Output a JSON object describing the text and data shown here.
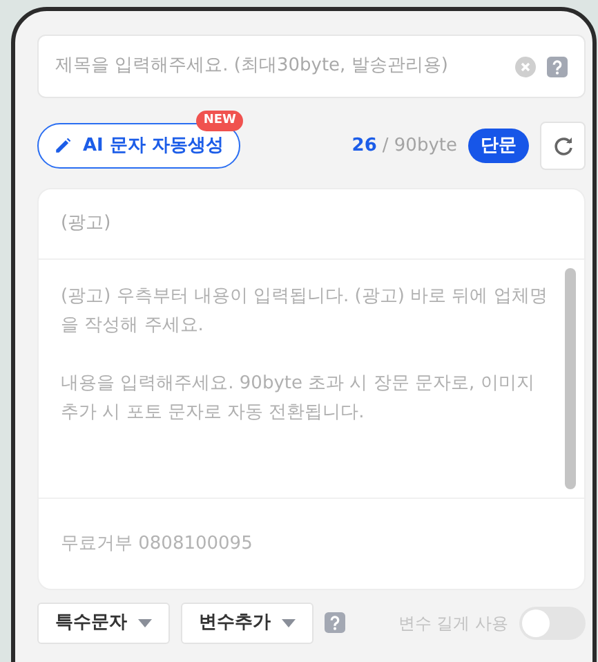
{
  "title_field": {
    "placeholder": "제목을 입력해주세요. (최대30byte, 발송관리용)"
  },
  "ai_button": {
    "label": "AI 문자 자동생성",
    "badge": "NEW"
  },
  "byte_counter": {
    "count": "26",
    "limit": "/ 90byte"
  },
  "message_type": {
    "label": "단문"
  },
  "message": {
    "prefix": "(광고)",
    "placeholder_paragraphs": [
      "(광고) 우측부터 내용이 입력됩니다. (광고) 바로 뒤에 업체명을 작성해 주세요.",
      "내용을 입력해주세요. 90byte 초과 시 장문 문자로, 이미지 추가 시 포토 문자로 자동 전환됩니다."
    ],
    "footer": "무료거부 0808100095"
  },
  "toolbar": {
    "buttons": [
      "특수문자",
      "변수추가"
    ],
    "toggle": {
      "label": "변수 길게 사용",
      "on": false
    }
  }
}
